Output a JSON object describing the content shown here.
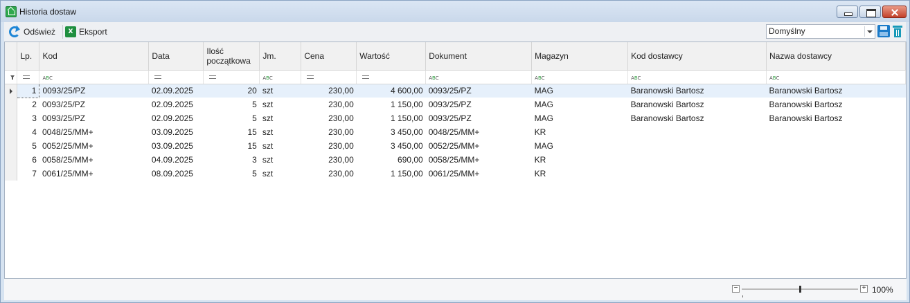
{
  "window": {
    "title": "Historia dostaw"
  },
  "toolbar": {
    "refresh_label": "Odśwież",
    "export_label": "Eksport",
    "layout_value": "Domyślny"
  },
  "grid": {
    "columns": [
      "Lp.",
      "Kod",
      "Data",
      "Ilość początkowa",
      "Jm.",
      "Cena",
      "Wartość",
      "Dokument",
      "Magazyn",
      "Kod dostawcy",
      "Nazwa dostawcy"
    ],
    "column_header_lines": {
      "ilosc_line1": "Ilość",
      "ilosc_line2": "początkowa"
    },
    "rows": [
      {
        "lp": "1",
        "kod": "0093/25/PZ",
        "data": "02.09.2025",
        "ilosc": "20",
        "jm": "szt",
        "cena": "230,00",
        "wartosc": "4 600,00",
        "dokument": "0093/25/PZ",
        "magazyn": "MAG",
        "kod_dostawcy": "Baranowski Bartosz",
        "nazwa_dostawcy": "Baranowski Bartosz"
      },
      {
        "lp": "2",
        "kod": "0093/25/PZ",
        "data": "02.09.2025",
        "ilosc": "5",
        "jm": "szt",
        "cena": "230,00",
        "wartosc": "1 150,00",
        "dokument": "0093/25/PZ",
        "magazyn": "MAG",
        "kod_dostawcy": "Baranowski Bartosz",
        "nazwa_dostawcy": "Baranowski Bartosz"
      },
      {
        "lp": "3",
        "kod": "0093/25/PZ",
        "data": "02.09.2025",
        "ilosc": "5",
        "jm": "szt",
        "cena": "230,00",
        "wartosc": "1 150,00",
        "dokument": "0093/25/PZ",
        "magazyn": "MAG",
        "kod_dostawcy": "Baranowski Bartosz",
        "nazwa_dostawcy": "Baranowski Bartosz"
      },
      {
        "lp": "4",
        "kod": "0048/25/MM+",
        "data": "03.09.2025",
        "ilosc": "15",
        "jm": "szt",
        "cena": "230,00",
        "wartosc": "3 450,00",
        "dokument": "0048/25/MM+",
        "magazyn": "KR",
        "kod_dostawcy": "",
        "nazwa_dostawcy": ""
      },
      {
        "lp": "5",
        "kod": "0052/25/MM+",
        "data": "03.09.2025",
        "ilosc": "15",
        "jm": "szt",
        "cena": "230,00",
        "wartosc": "3 450,00",
        "dokument": "0052/25/MM+",
        "magazyn": "MAG",
        "kod_dostawcy": "",
        "nazwa_dostawcy": ""
      },
      {
        "lp": "6",
        "kod": "0058/25/MM+",
        "data": "04.09.2025",
        "ilosc": "3",
        "jm": "szt",
        "cena": "230,00",
        "wartosc": "690,00",
        "dokument": "0058/25/MM+",
        "magazyn": "KR",
        "kod_dostawcy": "",
        "nazwa_dostawcy": ""
      },
      {
        "lp": "7",
        "kod": "0061/25/MM+",
        "data": "08.09.2025",
        "ilosc": "5",
        "jm": "szt",
        "cena": "230,00",
        "wartosc": "1 150,00",
        "dokument": "0061/25/MM+",
        "magazyn": "KR",
        "kod_dostawcy": "",
        "nazwa_dostawcy": ""
      }
    ]
  },
  "statusbar": {
    "zoom_label": "100%",
    "zoom_level": 0.5
  }
}
